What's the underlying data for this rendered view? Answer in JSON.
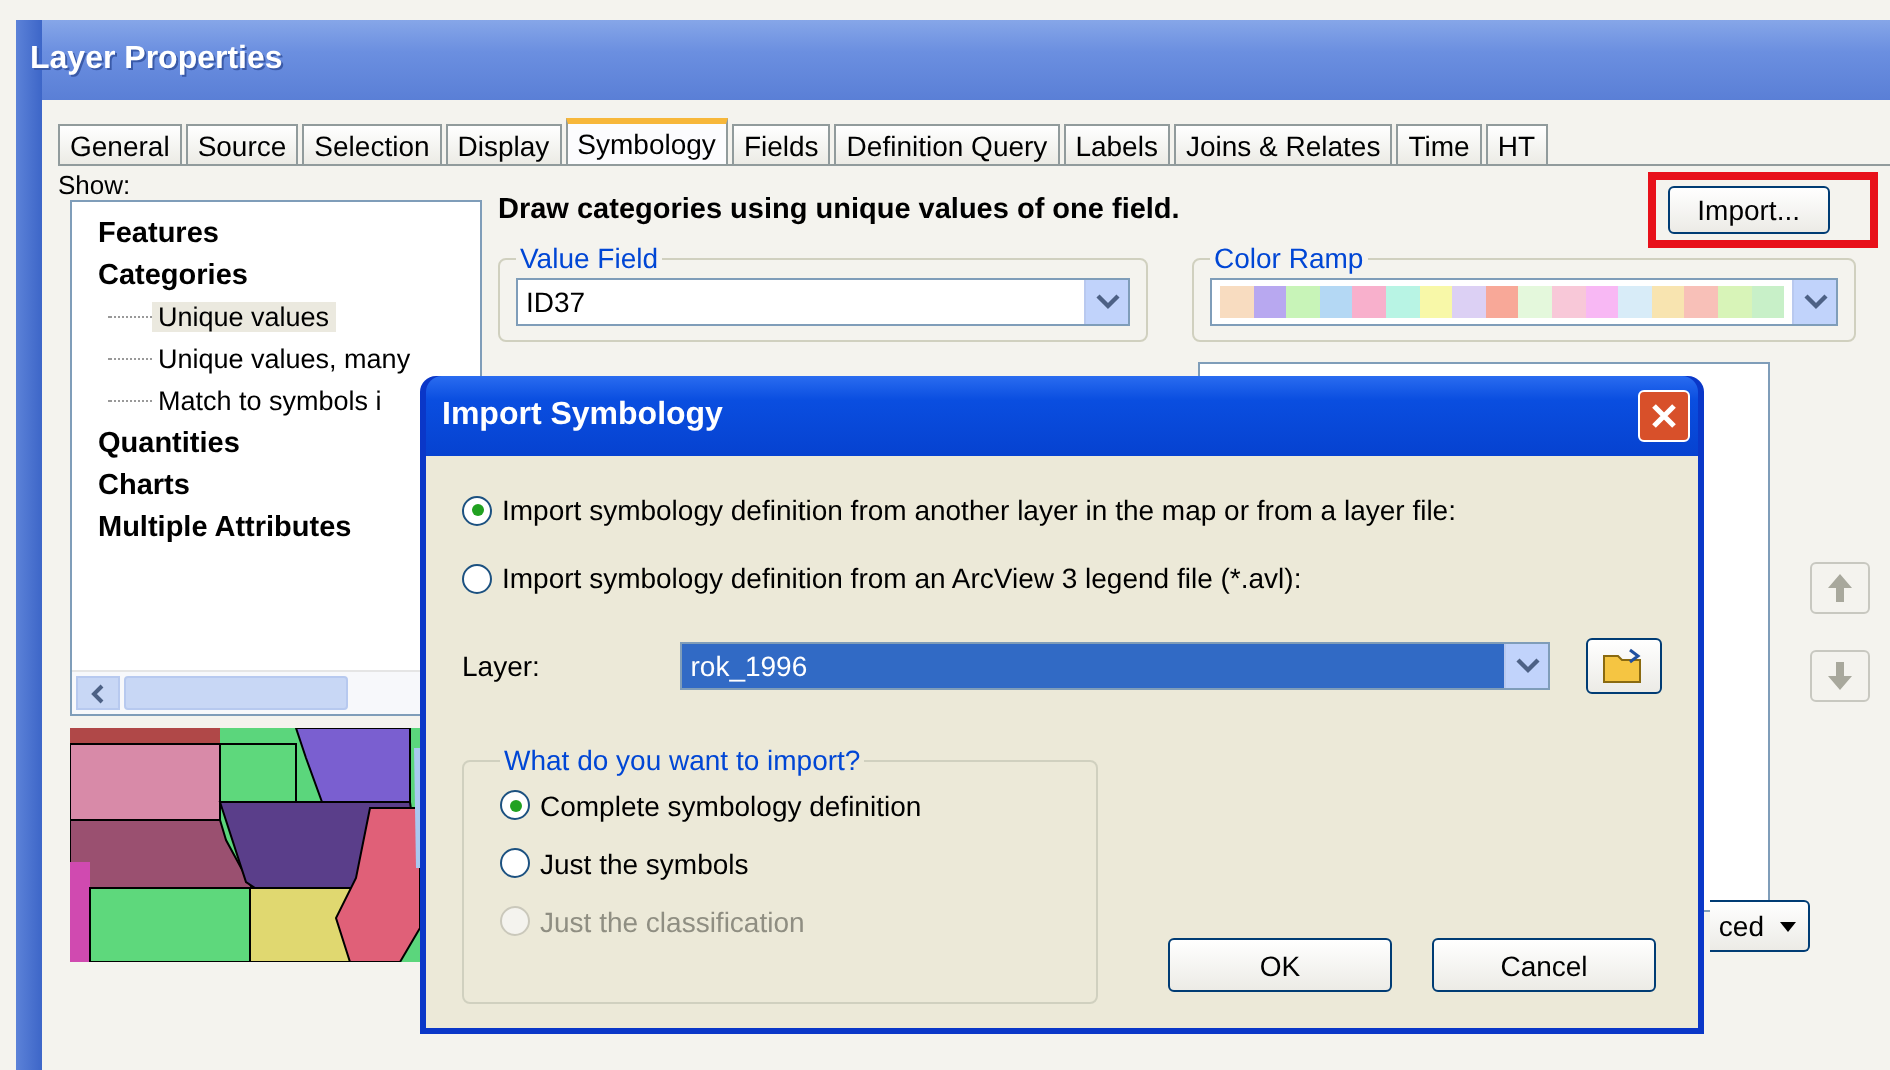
{
  "window": {
    "title": "Layer Properties"
  },
  "tabs": [
    {
      "label": "General",
      "selected": false
    },
    {
      "label": "Source",
      "selected": false
    },
    {
      "label": "Selection",
      "selected": false
    },
    {
      "label": "Display",
      "selected": false
    },
    {
      "label": "Symbology",
      "selected": true
    },
    {
      "label": "Fields",
      "selected": false
    },
    {
      "label": "Definition Query",
      "selected": false
    },
    {
      "label": "Labels",
      "selected": false
    },
    {
      "label": "Joins & Relates",
      "selected": false
    },
    {
      "label": "Time",
      "selected": false
    },
    {
      "label": "HT",
      "selected": false
    }
  ],
  "show": {
    "label": "Show:",
    "tree": [
      {
        "label": "Features",
        "selected": false
      },
      {
        "label": "Categories",
        "selected": false,
        "children": [
          {
            "label": "Unique values",
            "selected": true
          },
          {
            "label": "Unique values, many",
            "selected": false
          },
          {
            "label": "Match to symbols i",
            "selected": false
          }
        ]
      },
      {
        "label": "Quantities",
        "selected": false
      },
      {
        "label": "Charts",
        "selected": false
      },
      {
        "label": "Multiple Attributes",
        "selected": false
      }
    ]
  },
  "symbology": {
    "heading": "Draw categories using unique values of one field.",
    "import_button": "Import...",
    "value_field": {
      "label": "Value Field",
      "value": "ID37"
    },
    "color_ramp": {
      "label": "Color Ramp"
    },
    "advanced_button": "ced"
  },
  "dialog": {
    "title": "Import Symbology",
    "sources": [
      {
        "label": "Import symbology definition from another layer in the map or from a layer file:",
        "selected": true
      },
      {
        "label": "Import symbology definition from an ArcView 3 legend file (*.avl):",
        "selected": false
      }
    ],
    "layer": {
      "label": "Layer:",
      "value": "rok_1996"
    },
    "import_group": {
      "legend": "What do you want to import?",
      "options": [
        {
          "label": "Complete symbology definition",
          "selected": true,
          "disabled": false
        },
        {
          "label": "Just the symbols",
          "selected": false,
          "disabled": false
        },
        {
          "label": "Just the classification",
          "selected": false,
          "disabled": true
        }
      ]
    },
    "buttons": [
      "OK",
      "Cancel"
    ]
  }
}
